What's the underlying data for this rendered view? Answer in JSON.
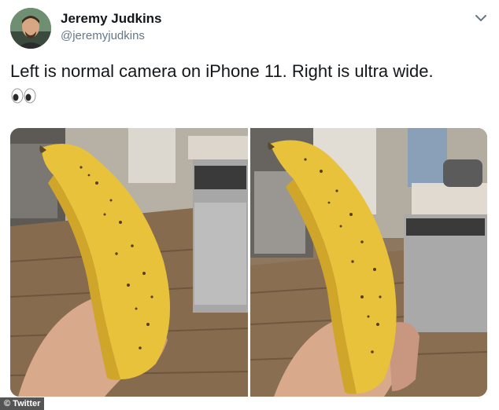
{
  "author": {
    "name": "Jeremy Judkins",
    "handle": "@jeremyjudkins"
  },
  "tweet": {
    "text": "Left is normal camera on iPhone 11. Right is ultra wide."
  },
  "credit": "© Twitter",
  "icons": {
    "menu": "chevron-down-icon",
    "eyes": "eyes-emoji-icon"
  },
  "colors": {
    "name": "#14171a",
    "handle": "#657786",
    "banana": "#e7c23a"
  }
}
